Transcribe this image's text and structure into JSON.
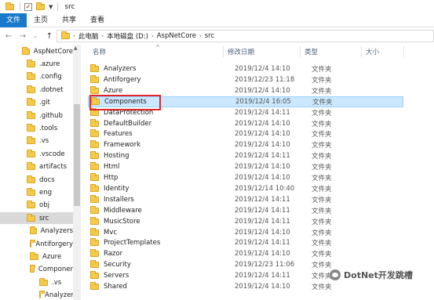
{
  "window": {
    "title": "src"
  },
  "ribbon": {
    "tabs": [
      "文件",
      "主页",
      "共享",
      "查看"
    ]
  },
  "address": {
    "crumbs": [
      "此电脑",
      "本地磁盘 (D:)",
      "AspNetCore",
      "src"
    ]
  },
  "nav": {
    "items": [
      {
        "label": "AspNetCore",
        "level": 0,
        "selected": false
      },
      {
        "label": ".azure",
        "level": 1,
        "selected": false
      },
      {
        "label": ".config",
        "level": 1,
        "selected": false
      },
      {
        "label": ".dotnet",
        "level": 1,
        "selected": false
      },
      {
        "label": ".git",
        "level": 1,
        "selected": false
      },
      {
        "label": ".github",
        "level": 1,
        "selected": false
      },
      {
        "label": ".tools",
        "level": 1,
        "selected": false
      },
      {
        "label": ".vs",
        "level": 1,
        "selected": false
      },
      {
        "label": ".vscode",
        "level": 1,
        "selected": false
      },
      {
        "label": "artifacts",
        "level": 1,
        "selected": false
      },
      {
        "label": "docs",
        "level": 1,
        "selected": false
      },
      {
        "label": "eng",
        "level": 1,
        "selected": false
      },
      {
        "label": "obj",
        "level": 1,
        "selected": false
      },
      {
        "label": "src",
        "level": 1,
        "selected": true
      },
      {
        "label": "Analyzers",
        "level": 2,
        "selected": false
      },
      {
        "label": "Antiforgery",
        "level": 2,
        "selected": false
      },
      {
        "label": "Azure",
        "level": 2,
        "selected": false
      },
      {
        "label": "Componer",
        "level": 2,
        "selected": false
      },
      {
        "label": ".vs",
        "level": 3,
        "selected": false
      },
      {
        "label": "Analyzers",
        "level": 3,
        "selected": false
      }
    ]
  },
  "columns": {
    "name": "名称",
    "date": "修改日期",
    "type": "类型",
    "size": "大小"
  },
  "files": [
    {
      "name": "Analyzers",
      "date": "2019/12/4 14:10",
      "type": "文件夹"
    },
    {
      "name": "Antiforgery",
      "date": "2019/12/23 11:18",
      "type": "文件夹"
    },
    {
      "name": "Azure",
      "date": "2019/12/4 14:10",
      "type": "文件夹"
    },
    {
      "name": "Components",
      "date": "2019/12/4 16:05",
      "type": "文件夹"
    },
    {
      "name": "DataProtection",
      "date": "2019/12/4 14:11",
      "type": "文件夹"
    },
    {
      "name": "DefaultBuilder",
      "date": "2019/12/4 14:10",
      "type": "文件夹"
    },
    {
      "name": "Features",
      "date": "2019/12/4 14:10",
      "type": "文件夹"
    },
    {
      "name": "Framework",
      "date": "2019/12/4 14:10",
      "type": "文件夹"
    },
    {
      "name": "Hosting",
      "date": "2019/12/4 14:11",
      "type": "文件夹"
    },
    {
      "name": "Html",
      "date": "2019/12/4 14:10",
      "type": "文件夹"
    },
    {
      "name": "Http",
      "date": "2019/12/4 14:10",
      "type": "文件夹"
    },
    {
      "name": "Identity",
      "date": "2019/12/14 10:40",
      "type": "文件夹"
    },
    {
      "name": "Installers",
      "date": "2019/12/4 14:11",
      "type": "文件夹"
    },
    {
      "name": "Middleware",
      "date": "2019/12/4 14:11",
      "type": "文件夹"
    },
    {
      "name": "MusicStore",
      "date": "2019/12/4 14:11",
      "type": "文件夹"
    },
    {
      "name": "Mvc",
      "date": "2019/12/4 14:10",
      "type": "文件夹"
    },
    {
      "name": "ProjectTemplates",
      "date": "2019/12/4 14:11",
      "type": "文件夹"
    },
    {
      "name": "Razor",
      "date": "2019/12/4 14:10",
      "type": "文件夹"
    },
    {
      "name": "Security",
      "date": "2019/12/23 11:06",
      "type": "文件夹"
    },
    {
      "name": "Servers",
      "date": "2019/12/4 14:11",
      "type": "文件夹"
    },
    {
      "name": "Shared",
      "date": "2019/12/4 14:10",
      "type": "文件夹"
    }
  ],
  "selected_file": "Components",
  "watermark": "DotNet开发跳槽",
  "colors": {
    "file_tab": "#1979ca",
    "selection": "#cce8ff",
    "highlight_box": "#e0262b",
    "folder": "#f6c94a"
  }
}
